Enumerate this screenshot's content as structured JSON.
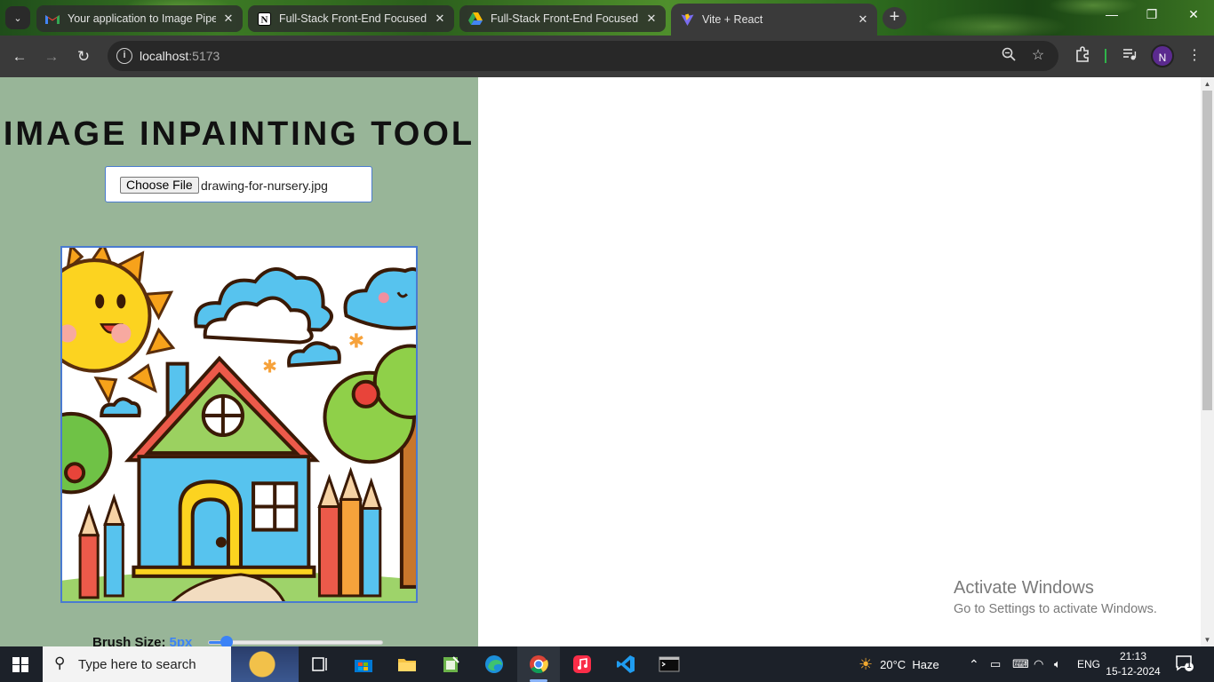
{
  "browser": {
    "tabs": [
      {
        "title": "Your application to Image Pipel",
        "favicon": "gmail-icon",
        "active": false
      },
      {
        "title": "Full-Stack Front-End Focused In",
        "favicon": "notion-icon",
        "active": false
      },
      {
        "title": "Full-Stack Front-End Focused In",
        "favicon": "google-drive-icon",
        "active": false
      },
      {
        "title": "Vite + React",
        "favicon": "vite-icon",
        "active": true
      }
    ],
    "url_host": "localhost",
    "url_port": ":5173",
    "profile_initial": "N"
  },
  "app": {
    "title": "IMAGE INPAINTING TOOL",
    "file_button_label": "Choose File",
    "file_name": "drawing-for-nursery.jpg",
    "brush_label": "Brush Size:",
    "brush_value": "5px",
    "brush_fraction": 0.1
  },
  "watermark": {
    "line1": "Activate Windows",
    "line2": "Go to Settings to activate Windows."
  },
  "taskbar": {
    "search_placeholder": "Type here to search",
    "weather": "20°C  Haze",
    "language": "ENG",
    "time": "21:13",
    "date": "15-12-2024",
    "notification_count": "1"
  }
}
